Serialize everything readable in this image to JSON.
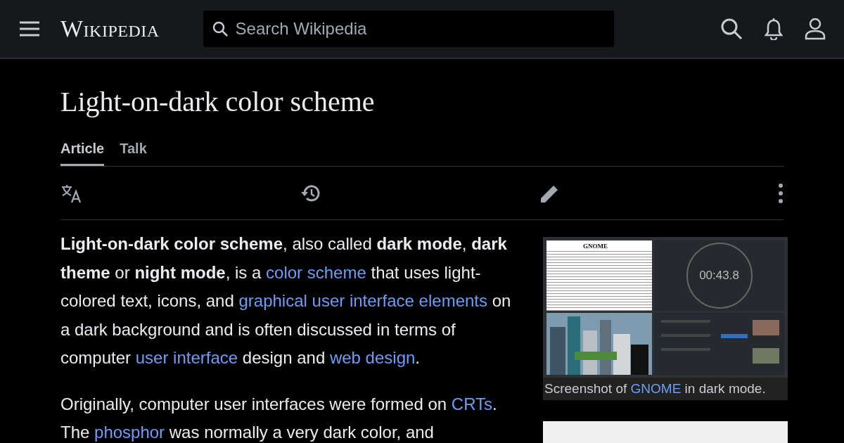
{
  "header": {
    "logo": "Wikipedia",
    "search": {
      "placeholder": "Search Wikipedia"
    }
  },
  "title": "Light-on-dark color scheme",
  "tabs": [
    {
      "label": "Article",
      "selected": true
    },
    {
      "label": "Talk",
      "selected": false
    }
  ],
  "paragraphs": [
    [
      {
        "kind": "bold",
        "text": "Light-on-dark color scheme"
      },
      {
        "kind": "plain",
        "text": ", also called "
      },
      {
        "kind": "bold",
        "text": "dark mode"
      },
      {
        "kind": "plain",
        "text": ", "
      },
      {
        "kind": "bold",
        "text": "dark theme"
      },
      {
        "kind": "plain",
        "text": " or "
      },
      {
        "kind": "bold",
        "text": "night mode"
      },
      {
        "kind": "plain",
        "text": ", is a "
      },
      {
        "kind": "link",
        "text": "color scheme"
      },
      {
        "kind": "plain",
        "text": " that uses light-colored text, icons, and "
      },
      {
        "kind": "link",
        "text": "graphical user interface elements"
      },
      {
        "kind": "plain",
        "text": " on a dark background and is often discussed in terms of computer "
      },
      {
        "kind": "link",
        "text": "user interface"
      },
      {
        "kind": "plain",
        "text": " design and "
      },
      {
        "kind": "link",
        "text": "web design"
      },
      {
        "kind": "plain",
        "text": "."
      }
    ],
    [
      {
        "kind": "plain",
        "text": "Originally, computer user interfaces were formed on "
      },
      {
        "kind": "link",
        "text": "CRTs"
      },
      {
        "kind": "plain",
        "text": ". The "
      },
      {
        "kind": "link",
        "text": "phosphor"
      },
      {
        "kind": "plain",
        "text": " was normally a very dark color, and"
      }
    ]
  ],
  "figure": {
    "screenshot": {
      "document_heading": "GNOME",
      "timer": "00:43.8"
    },
    "caption": [
      {
        "kind": "plain",
        "text": "Screenshot of "
      },
      {
        "kind": "link",
        "text": "GNOME"
      },
      {
        "kind": "plain",
        "text": " in dark mode."
      }
    ]
  }
}
